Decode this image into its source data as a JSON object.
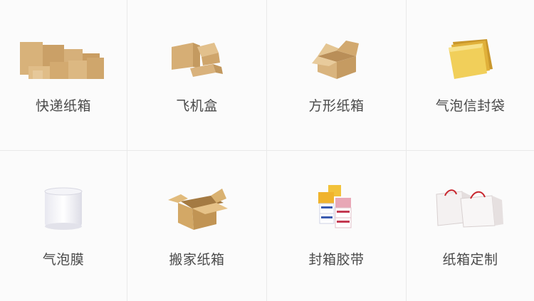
{
  "categories": [
    {
      "label": "快递纸箱",
      "icon": "corrugated-boxes-icon"
    },
    {
      "label": "飞机盒",
      "icon": "airplane-box-icon"
    },
    {
      "label": "方形纸箱",
      "icon": "square-carton-icon"
    },
    {
      "label": "气泡信封袋",
      "icon": "bubble-envelope-icon"
    },
    {
      "label": "气泡膜",
      "icon": "bubble-wrap-roll-icon"
    },
    {
      "label": "搬家纸箱",
      "icon": "moving-box-icon"
    },
    {
      "label": "封箱胶带",
      "icon": "packing-tape-icon"
    },
    {
      "label": "纸箱定制",
      "icon": "custom-gift-box-icon"
    }
  ]
}
